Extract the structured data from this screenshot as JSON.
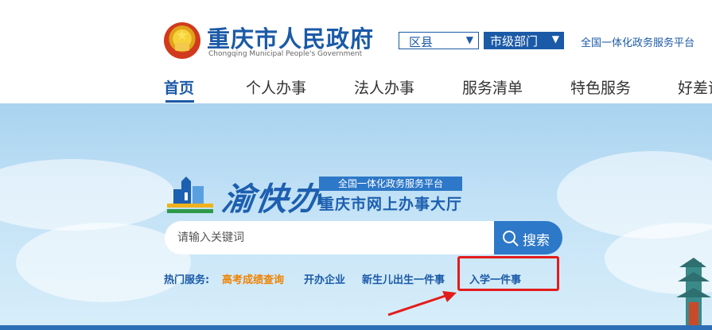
{
  "header": {
    "brand_cn": "重庆市人民政府",
    "brand_en": "Chongqing Municipal People's Government",
    "district_select": {
      "label": "区县",
      "arrow": "▼"
    },
    "dept_select": {
      "label": "市级部门",
      "arrow": "▼"
    },
    "platform_link": "全国一体化政务服务平台"
  },
  "nav": {
    "items": [
      {
        "label": "首页"
      },
      {
        "label": "个人办事"
      },
      {
        "label": "法人办事"
      },
      {
        "label": "服务清单"
      },
      {
        "label": "特色服务"
      },
      {
        "label": "好差评"
      }
    ]
  },
  "logo": {
    "script": "渝快办",
    "tag": "全国一体化政务服务平台",
    "hall": "重庆市网上办事大厅"
  },
  "search": {
    "placeholder": "请输入关键词",
    "button_label": "搜索"
  },
  "hot_services": {
    "label": "热门服务:",
    "items": [
      {
        "label": "高考成绩查询",
        "color": "#f08300"
      },
      {
        "label": "开办企业"
      },
      {
        "label": "新生儿出生一件事"
      },
      {
        "label": "入学一件事"
      }
    ]
  },
  "colors": {
    "brand_blue": "#1b5aa7",
    "accent_orange": "#f08300",
    "highlight_red": "#e21c1c"
  },
  "icons": [
    "national-emblem-icon",
    "search-icon",
    "chevron-down-icon",
    "arrow-icon"
  ]
}
